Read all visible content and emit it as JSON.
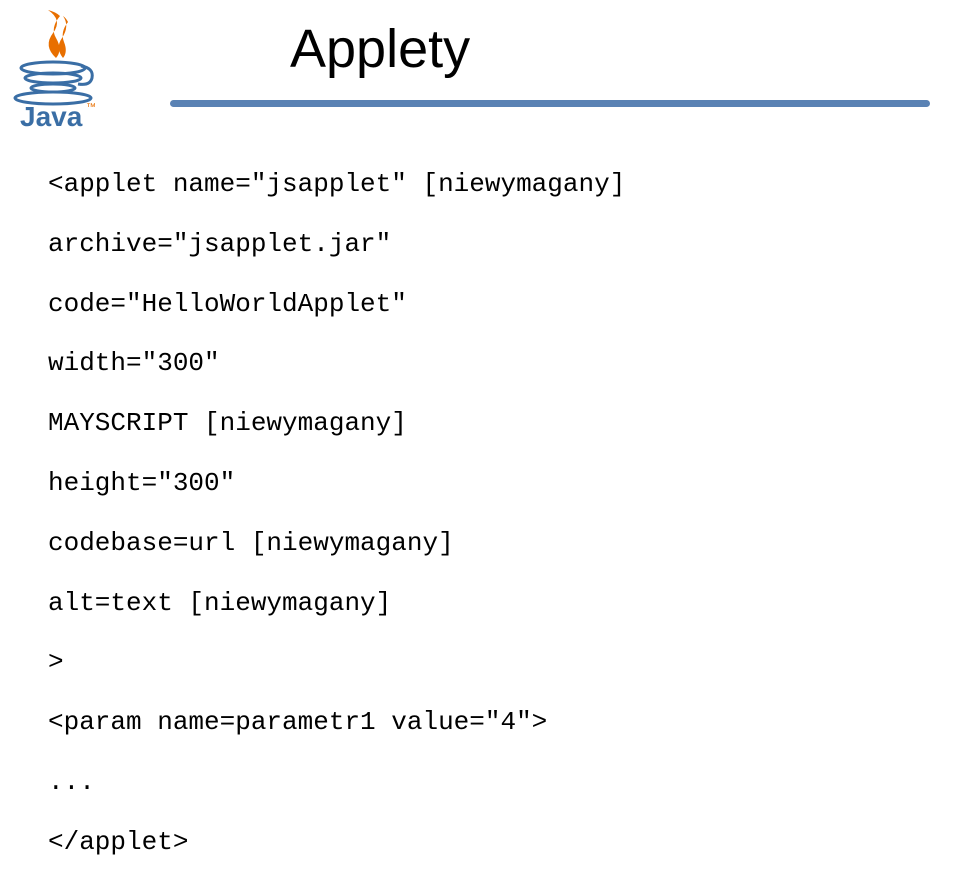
{
  "title": "Applety",
  "code": {
    "line1": "<applet name=\"jsapplet\" [niewymagany]",
    "line2": "archive=\"jsapplet.jar\"",
    "line3": "code=\"HelloWorldApplet\"",
    "line4": "width=\"300\"",
    "line5": "MAYSCRIPT [niewymagany]",
    "line6": "height=\"300\"",
    "line7": "codebase=url [niewymagany]",
    "line8": "alt=text [niewymagany]",
    "line9": ">",
    "line10": "<param name=parametr1 value=\"4\">",
    "line11": "...",
    "line12": "</applet>"
  },
  "logo": {
    "name": "java-logo",
    "text": "Java",
    "colors": {
      "steam": "#e86f00",
      "cup": "#3a6ea5",
      "text": "#3a6ea5"
    }
  }
}
